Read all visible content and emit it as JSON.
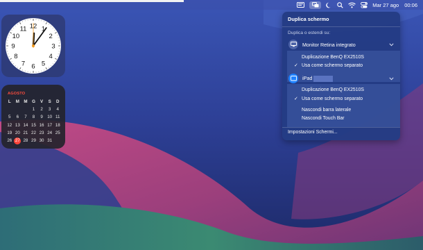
{
  "menubar": {
    "icons": [
      "menubar-app-icon",
      "screen-mirroring-icon",
      "moon-icon",
      "search-icon",
      "wifi-icon",
      "control-center-icon"
    ],
    "date": "Mar 27 ago",
    "time": "00:06"
  },
  "clock_widget": {
    "numbers": [
      "12",
      "1",
      "2",
      "3",
      "4",
      "5",
      "6",
      "7",
      "8",
      "9",
      "10",
      "11"
    ],
    "hour_hand_angle_deg": 3,
    "minute_hand_angle_deg": 36
  },
  "calendar_widget": {
    "month": "AGOSTO",
    "weekdays": [
      "L",
      "M",
      "M",
      "G",
      "V",
      "S",
      "D"
    ],
    "leading_blanks": 3,
    "days": [
      "1",
      "2",
      "3",
      "4",
      "5",
      "6",
      "7",
      "8",
      "9",
      "10",
      "11",
      "12",
      "13",
      "14",
      "15",
      "16",
      "17",
      "18",
      "19",
      "20",
      "21",
      "22",
      "23",
      "24",
      "25",
      "26",
      "27",
      "28",
      "29",
      "30",
      "31"
    ],
    "today": "27",
    "today_color": "#ff453a"
  },
  "panel": {
    "title": "Duplica schermo",
    "subtitle": "Duplica o estendi su:",
    "devices": [
      {
        "name": "Monitor Retina integrato",
        "icon": "display-icon",
        "options": [
          {
            "label": "Duplicazione BenQ EX2510S",
            "checked": false
          },
          {
            "label": "Usa come schermo separato",
            "checked": true
          }
        ]
      },
      {
        "name": "iPad",
        "icon": "ipad-icon",
        "options": [
          {
            "label": "Duplicazione BenQ EX2510S",
            "checked": false
          },
          {
            "label": "Usa come schermo separato",
            "checked": true
          },
          {
            "label": "Nascondi barra laterale",
            "checked": false
          },
          {
            "label": "Nascondi Touch Bar",
            "checked": false
          }
        ]
      }
    ],
    "footer": "Impostazioni Schermi...",
    "accent": "#1f82ff"
  }
}
